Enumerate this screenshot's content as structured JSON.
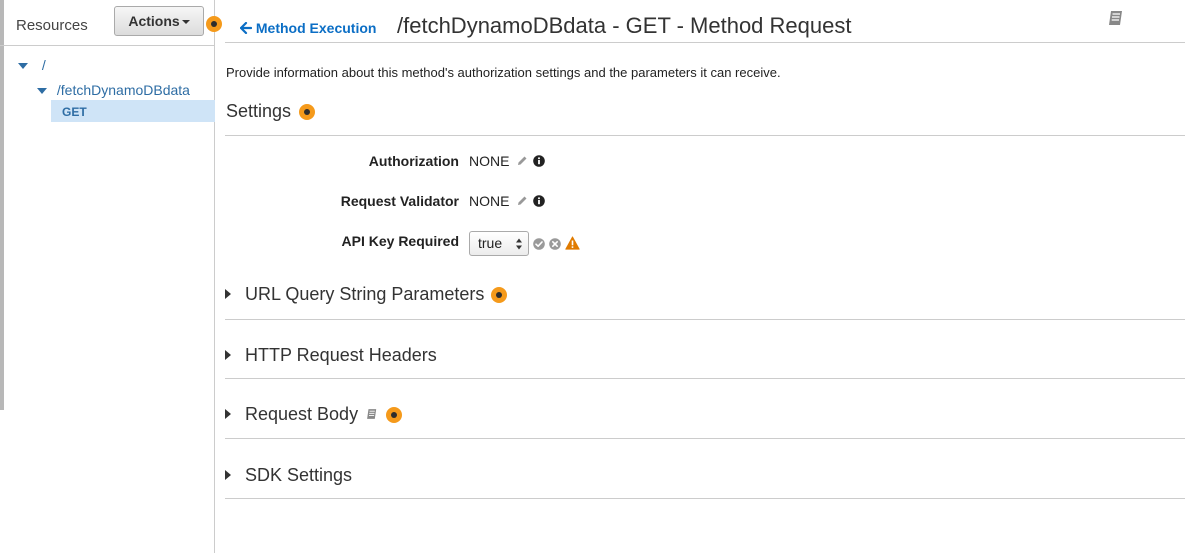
{
  "sidebar": {
    "resources_title": "Resources",
    "actions_label": "Actions",
    "tree": [
      {
        "label": "/"
      },
      {
        "label": "/fetchDynamoDBdata"
      },
      {
        "label": "GET"
      }
    ]
  },
  "header": {
    "back_label": "Method Execution",
    "title": "/fetchDynamoDBdata - GET - Method Request"
  },
  "description": "Provide information about this method's authorization settings and the parameters it can receive.",
  "settings": {
    "title": "Settings",
    "authorization_label": "Authorization",
    "authorization_value": "NONE",
    "validator_label": "Request Validator",
    "validator_value": "NONE",
    "api_key_label": "API Key Required",
    "api_key_value": "true"
  },
  "sections": [
    {
      "label": "URL Query String Parameters"
    },
    {
      "label": "HTTP Request Headers"
    },
    {
      "label": "Request Body"
    },
    {
      "label": "SDK Settings"
    }
  ],
  "colors": {
    "accent": "#f59a1b",
    "link": "#0b6ec5",
    "selected": "#cfe4f7",
    "warning": "#e07b00"
  },
  "icons": [
    "info-dot-icon",
    "pencil-icon",
    "info-circle-icon",
    "check-circle-icon",
    "x-circle-icon",
    "warning-icon",
    "book-icon",
    "arrow-left-icon",
    "caret-down-icon"
  ]
}
